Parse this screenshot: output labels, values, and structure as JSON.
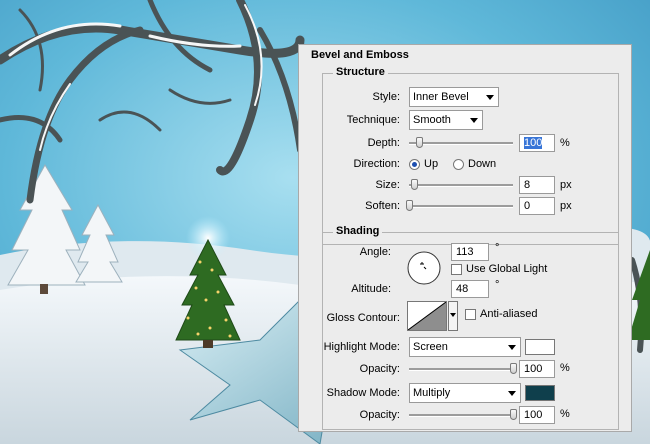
{
  "panel": {
    "title": "Bevel and Emboss"
  },
  "structure": {
    "title": "Structure",
    "style": {
      "label": "Style:",
      "value": "Inner Bevel"
    },
    "technique": {
      "label": "Technique:",
      "value": "Smooth"
    },
    "depth": {
      "label": "Depth:",
      "value": "100",
      "unit": "%",
      "slider_fraction": 0.1
    },
    "direction": {
      "label": "Direction:",
      "up": "Up",
      "down": "Down",
      "selected": "Up"
    },
    "size": {
      "label": "Size:",
      "value": "8",
      "unit": "px",
      "slider_fraction": 0.05
    },
    "soften": {
      "label": "Soften:",
      "value": "0",
      "unit": "px",
      "slider_fraction": 0.0
    }
  },
  "shading": {
    "title": "Shading",
    "angle": {
      "label": "Angle:",
      "value": "113",
      "unit": "°"
    },
    "global_light": {
      "label": "Use Global Light",
      "checked": false
    },
    "altitude": {
      "label": "Altitude:",
      "value": "48",
      "unit": "°"
    },
    "gloss_contour": {
      "label": "Gloss Contour:"
    },
    "anti_aliased": {
      "label": "Anti-aliased",
      "checked": false
    },
    "highlight_mode": {
      "label": "Highlight Mode:",
      "value": "Screen",
      "color": "#ffffff"
    },
    "highlight_opacity": {
      "label": "Opacity:",
      "value": "100",
      "unit": "%",
      "slider_fraction": 1.0
    },
    "shadow_mode": {
      "label": "Shadow Mode:",
      "value": "Multiply",
      "color": "#0f3f4c"
    },
    "shadow_opacity": {
      "label": "Opacity:",
      "value": "100",
      "unit": "%",
      "slider_fraction": 1.0
    }
  },
  "colors": {
    "sky": "#5fb3d6",
    "snow": "#e8eef2",
    "accent": "#3875d7"
  }
}
